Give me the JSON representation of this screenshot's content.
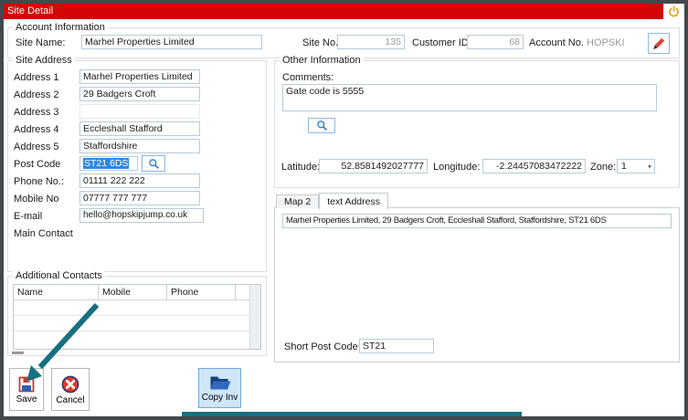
{
  "window": {
    "title": "Site Detail"
  },
  "colors": {
    "titlebar_red": "#d40505",
    "annotation_teal": "#16707f",
    "selection_blue": "#2f88e0",
    "highlight_button_blue": "#cfe6f8"
  },
  "account": {
    "group_label": "Account Information",
    "site_name": {
      "label": "Site Name:",
      "value": "Marhel Properties Limited"
    },
    "site_no": {
      "label": "Site No.",
      "value": "135"
    },
    "customer_id": {
      "label": "Customer ID:",
      "value": "68"
    },
    "account_no": {
      "label": "Account No.",
      "value": "HOPSKI"
    }
  },
  "site_address": {
    "group_label": "Site Address",
    "fields": [
      {
        "label": "Address 1",
        "value": "Marhel Properties Limited"
      },
      {
        "label": "Address 2",
        "value": "29 Badgers Croft"
      },
      {
        "label": "Address 3",
        "value": ""
      },
      {
        "label": "Address 4",
        "value": "Eccleshall Stafford"
      },
      {
        "label": "Address 5",
        "value": "Staffordshire"
      }
    ],
    "post_code": {
      "label": "Post Code",
      "value": "ST21 6DS"
    },
    "phone": {
      "label": "Phone No.:",
      "value": "01111 222 222"
    },
    "mobile": {
      "label": "Mobile No",
      "value": "07777 777 777"
    },
    "email": {
      "label": "E-mail",
      "value": "hello@hopskipjump.co.uk"
    },
    "main_contact": {
      "label": "Main Contact",
      "value": ""
    }
  },
  "other_info": {
    "group_label": "Other Information",
    "comments_label": "Comments:",
    "comments_value": "Gate code is 5555",
    "latitude": {
      "label": "Latitude:",
      "value": "52.8581492027777"
    },
    "longitude": {
      "label": "Longitude:",
      "value": "-2.24457083472222"
    },
    "zone": {
      "label": "Zone:",
      "value": "1"
    }
  },
  "address_tabs": {
    "tabs": [
      {
        "label": "Map 2"
      },
      {
        "label": "text Address"
      }
    ],
    "full_address": "Marhel Properties Limited, 29 Badgers Croft, Eccleshall Stafford, Staffordshire, ST21 6DS",
    "short_post_code": {
      "label": "Short Post Code",
      "value": "ST21"
    }
  },
  "additional_contacts": {
    "group_label": "Additional Contacts",
    "columns": [
      "Name",
      "Mobile",
      "Phone"
    ]
  },
  "actions": {
    "save": "Save",
    "cancel": "Cancel",
    "copy_inv": "Copy Inv"
  }
}
